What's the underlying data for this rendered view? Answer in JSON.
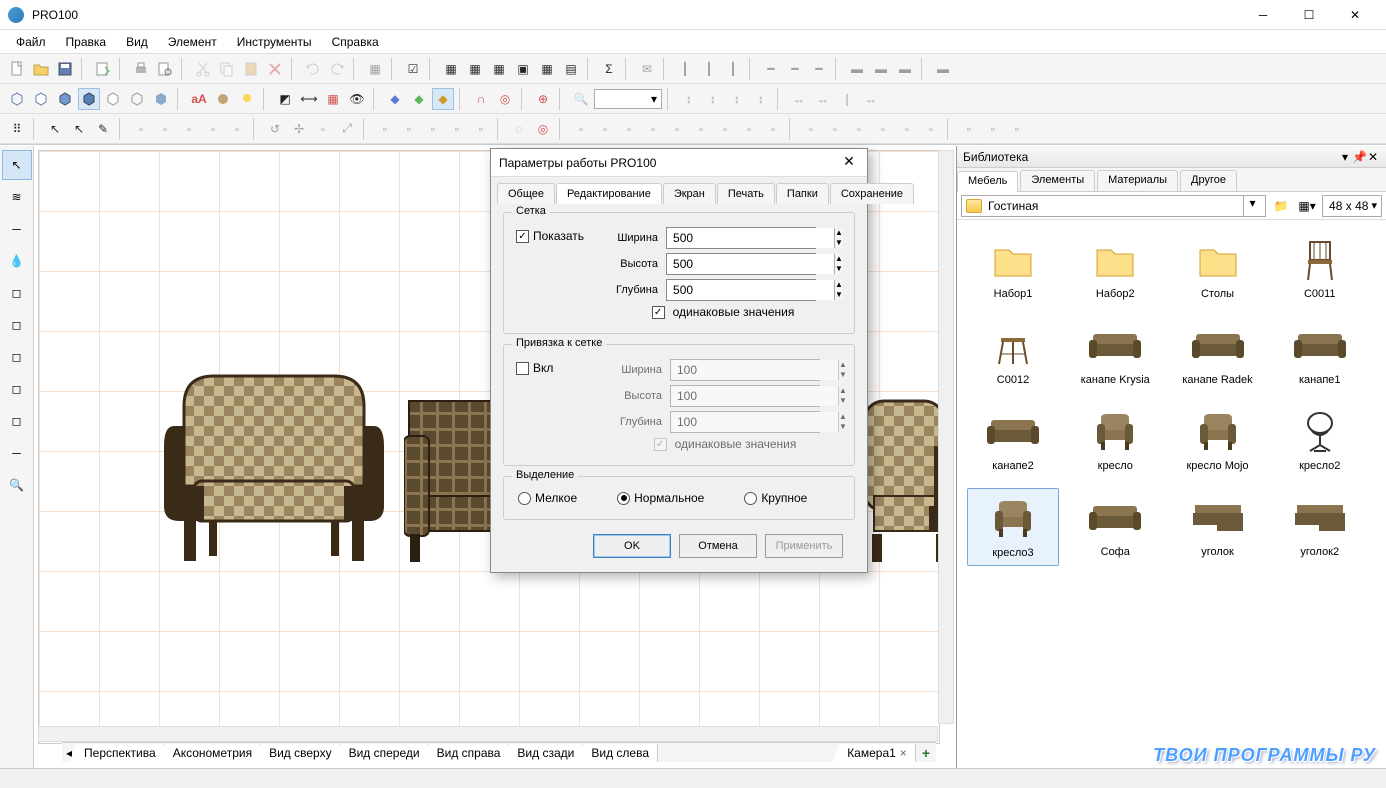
{
  "window": {
    "title": "PRO100"
  },
  "menu": [
    "Файл",
    "Правка",
    "Вид",
    "Элемент",
    "Инструменты",
    "Справка"
  ],
  "dialog": {
    "title": "Параметры работы PRO100",
    "tabs": [
      "Общее",
      "Редактирование",
      "Экран",
      "Печать",
      "Папки",
      "Сохранение"
    ],
    "active_tab": "Редактирование",
    "grid": {
      "legend": "Сетка",
      "show_label": "Показать",
      "show": true,
      "width_label": "Ширина",
      "width": "500",
      "height_label": "Высота",
      "height": "500",
      "depth_label": "Глубина",
      "depth": "500",
      "same_label": "одинаковые значения",
      "same": true
    },
    "snap": {
      "legend": "Привязка к сетке",
      "enable_label": "Вкл",
      "enable": false,
      "width_label": "Ширина",
      "width": "100",
      "height_label": "Высота",
      "height": "100",
      "depth_label": "Глубина",
      "depth": "100",
      "same_label": "одинаковые значения",
      "same": true
    },
    "selection": {
      "legend": "Выделение",
      "small": "Мелкое",
      "normal": "Нормальное",
      "large": "Крупное",
      "value": "normal"
    },
    "buttons": {
      "ok": "OK",
      "cancel": "Отмена",
      "apply": "Применить"
    }
  },
  "library": {
    "title": "Библиотека",
    "tabs": [
      "Мебель",
      "Элементы",
      "Материалы",
      "Другое"
    ],
    "active_tab": "Мебель",
    "folder": "Гостиная",
    "thumb_size": "48 x  48",
    "items": [
      {
        "label": "Набор1",
        "icon": "folder"
      },
      {
        "label": "Набор2",
        "icon": "folder"
      },
      {
        "label": "Столы",
        "icon": "folder"
      },
      {
        "label": "C0011",
        "icon": "chair"
      },
      {
        "label": "C0012",
        "icon": "stool"
      },
      {
        "label": "канапе Krysia",
        "icon": "sofa"
      },
      {
        "label": "канапе Radek",
        "icon": "sofa"
      },
      {
        "label": "канапе1",
        "icon": "sofa"
      },
      {
        "label": "канапе2",
        "icon": "sofa"
      },
      {
        "label": "кресло",
        "icon": "armchair"
      },
      {
        "label": "кресло Mojo",
        "icon": "armchair"
      },
      {
        "label": "кресло2",
        "icon": "wirechair"
      },
      {
        "label": "кресло3",
        "icon": "armchair",
        "selected": true
      },
      {
        "label": "Софа",
        "icon": "sofa"
      },
      {
        "label": "уголок",
        "icon": "corner"
      },
      {
        "label": "уголок2",
        "icon": "corner"
      }
    ]
  },
  "view_tabs": [
    "Перспектива",
    "Аксонометрия",
    "Вид сверху",
    "Вид спереди",
    "Вид справа",
    "Вид сзади",
    "Вид слева"
  ],
  "camera_tab": "Камера1",
  "watermark": "ТВОИ ПРОГРАММЫ РУ"
}
